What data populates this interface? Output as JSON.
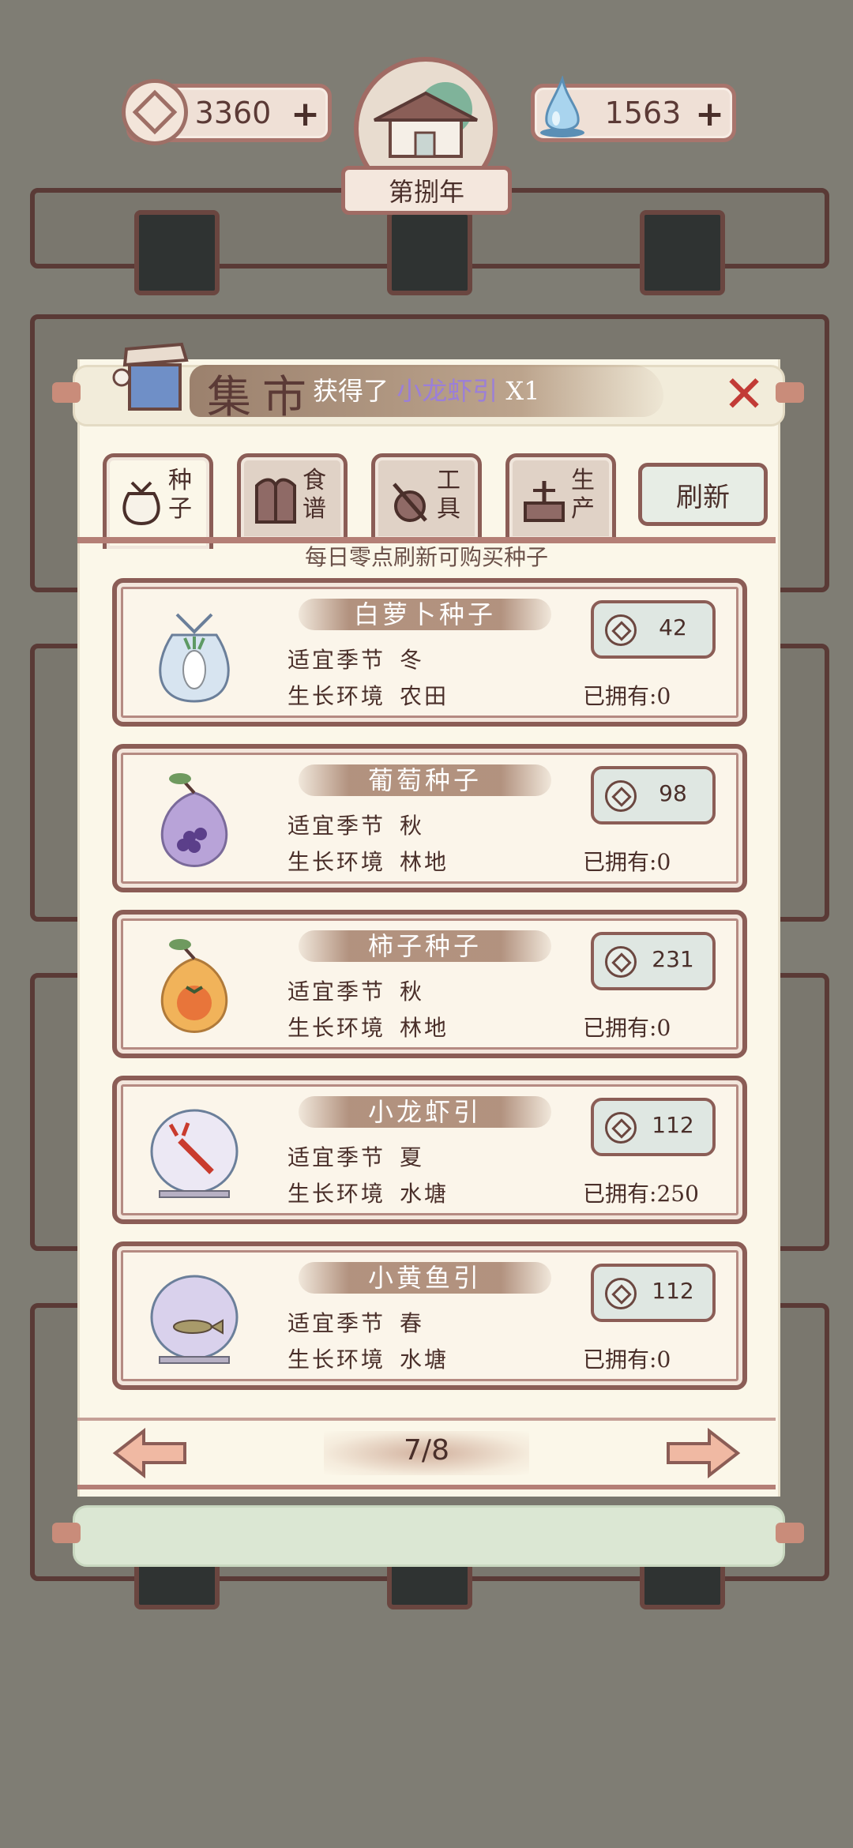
{
  "hud": {
    "coins": "3360",
    "water": "1563",
    "year_label": "第捌年",
    "plus_symbol": "+"
  },
  "dialog": {
    "title": "集市",
    "obtained_prefix": "获得了",
    "obtained_item": "小龙虾引",
    "obtained_count": "X1",
    "close_symbol": "✕"
  },
  "tabs": [
    {
      "label": "种子",
      "icon": "seed-bag-icon",
      "active": true
    },
    {
      "label": "食谱",
      "icon": "recipe-book-icon",
      "active": false
    },
    {
      "label": "工具",
      "icon": "tools-icon",
      "active": false
    },
    {
      "label": "生产",
      "icon": "production-icon",
      "active": false
    }
  ],
  "refresh_label": "刷新",
  "hint": "每日零点刷新可购买种子",
  "labels": {
    "season": "适宜季节",
    "environment": "生长环境",
    "owned_prefix": "已拥有:"
  },
  "items": [
    {
      "name": "白萝卜种子",
      "season": "冬",
      "environment": "农田",
      "price": "42",
      "owned": "0",
      "icon": "radish-seed-bag-icon",
      "tint": "#d7e4f0"
    },
    {
      "name": "葡萄种子",
      "season": "秋",
      "environment": "林地",
      "price": "98",
      "owned": "0",
      "icon": "grape-seed-bag-icon",
      "tint": "#b8a3d8"
    },
    {
      "name": "柿子种子",
      "season": "秋",
      "environment": "林地",
      "price": "231",
      "owned": "0",
      "icon": "persimmon-seed-bag-icon",
      "tint": "#f1b35a"
    },
    {
      "name": "小龙虾引",
      "season": "夏",
      "environment": "水塘",
      "price": "112",
      "owned": "250",
      "icon": "crayfish-bowl-icon",
      "tint": "#ece8f4"
    },
    {
      "name": "小黄鱼引",
      "season": "春",
      "environment": "水塘",
      "price": "112",
      "owned": "0",
      "icon": "yellow-fish-bowl-icon",
      "tint": "#d9d1ec"
    }
  ],
  "pagination": {
    "current": "7/8"
  },
  "colors": {
    "background": "#7f7d74",
    "panel": "#fbf7e9",
    "border": "#8b5d56",
    "close": "#c23b36",
    "highlight_item": "#9b7fd8"
  }
}
